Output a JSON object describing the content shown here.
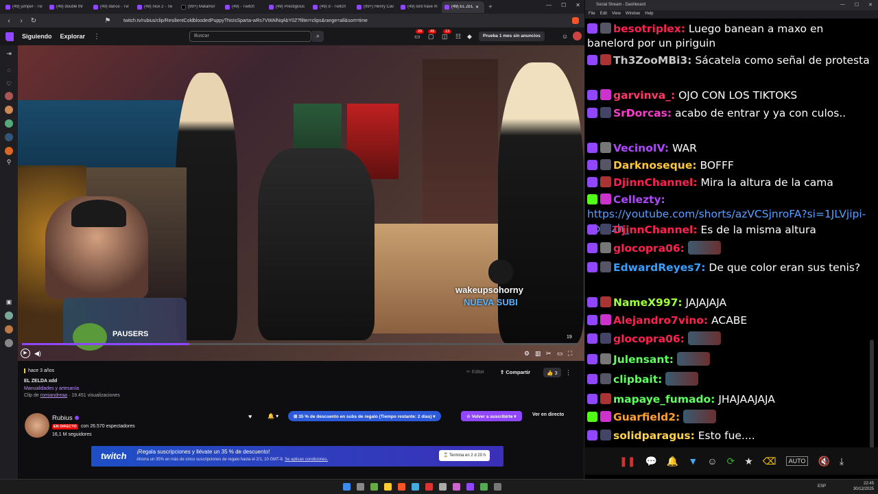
{
  "browser": {
    "tabs": [
      {
        "label": "(49) jumper - Tw"
      },
      {
        "label": "(49) double thr"
      },
      {
        "label": "(49) dance - Tw"
      },
      {
        "label": "(49) nice 2 - Tw"
      },
      {
        "label": "(99+) Matamor"
      },
      {
        "label": "(49) - Twitch"
      },
      {
        "label": "(49) Prestigious"
      },
      {
        "label": "(49) d - Twitch"
      },
      {
        "label": "(99+) Henry Cav"
      },
      {
        "label": "(49) lord have m"
      },
      {
        "label": "(49) EL ZEL"
      }
    ],
    "url": "twitch.tv/rubius/clip/ResilientColdbloodedPuppyThisIsSparta-wRs7VWAlNqAbY0Z?filter=clips&range=all&sort=time"
  },
  "twitch_top": {
    "following": "Siguiendo",
    "explore": "Explorar",
    "search_placeholder": "Buscar",
    "badge_1": "29",
    "badge_2": "49",
    "badge_3": "13",
    "prime": "Prueba 1 mes sin anuncios"
  },
  "player": {
    "overlay_user": "wakeupsohorny",
    "overlay_sub": "NUEVA SUBI",
    "pausers": "PAUSERS",
    "counter": "19"
  },
  "clip": {
    "date": "hace 3 años",
    "title": "EL ZELDA xdd",
    "category": "Manualidades y artesanía",
    "by_prefix": "Clip de",
    "author": "romiandreaa",
    "views": "· 19.451 visualizaciones",
    "edit": "Editar",
    "share": "Compartir",
    "likes": "3"
  },
  "channel": {
    "name": "Rubius",
    "live": "EN DIRECTO",
    "viewers": "con 26.570 espectadores",
    "followers": "16,1 M seguidores",
    "promo": "35 % de descuento en subs de regalo (Tiempo restante: 2 días)",
    "resub": "Volver a suscribirte",
    "watch_live": "Ver en directo"
  },
  "banner": {
    "logo": "twitch",
    "headline": "¡Regala suscripciones y llévate un 35 % de descuento!",
    "subtext": "Ahorra un 35% en más de cinco suscripciones de regalo hasta el 2/1, 10 GMT-8.",
    "terms": "Se aplican condiciones.",
    "timer": "Termina en 2 d 20 h"
  },
  "chat_window": {
    "title": "Social Stream - Dashboard",
    "menu": [
      "File",
      "Edit",
      "View",
      "Window",
      "Help"
    ]
  },
  "chat": [
    {
      "user": "besotriplex:",
      "color": "#ff2050",
      "text": "Luego banean a maxo en banelord por un piriguin",
      "icon": "tw"
    },
    {
      "user": "Th3ZooMBi3:",
      "color": "#c8c8c8",
      "text": "Sácatela como señal de protesta",
      "icon": "tw"
    },
    {
      "user": "garvinva_:",
      "color": "#ff3a6a",
      "text": "OJO CON LOS TIKTOKS",
      "icon": "tw"
    },
    {
      "user": "SrDorcas:",
      "color": "#ff3ad0",
      "text": "acabo de entrar y ya con culos..",
      "icon": "tw"
    },
    {
      "user": "VecinoIV:",
      "color": "#b048ff",
      "text": "WAR",
      "icon": "tw"
    },
    {
      "user": "Darknoseque:",
      "color": "#ffc83a",
      "text": "BOFFF",
      "icon": "tw"
    },
    {
      "user": "DjinnChannel:",
      "color": "#ff2050",
      "text": "Mira la altura de la cama",
      "icon": "tw"
    },
    {
      "user": "Cellezty:",
      "color": "#b048ff",
      "text": "https://youtube.com/shorts/azVCSjnroFA?si=1JLVjipi-obtKzh_",
      "icon": "kick"
    },
    {
      "user": "DjinnChannel:",
      "color": "#ff2050",
      "text": "Es de la misma altura",
      "icon": "tw"
    },
    {
      "user": "glocopra06:",
      "color": "#ff2050",
      "text": "",
      "icon": "tw"
    },
    {
      "user": "EdwardReyes7:",
      "color": "#3aa0ff",
      "text": "De que color eran sus tenis?",
      "icon": "tw"
    },
    {
      "user": "NameX997:",
      "color": "#a0ff3a",
      "text": "JAJAJAJA",
      "icon": "tw"
    },
    {
      "user": "Alejandro7vino:",
      "color": "#ff2050",
      "text": "ACABE",
      "icon": "tw"
    },
    {
      "user": "glocopra06:",
      "color": "#ff2050",
      "text": "",
      "icon": "tw"
    },
    {
      "user": "Julensant:",
      "color": "#60ff60",
      "text": "",
      "icon": "tw"
    },
    {
      "user": "clipbait:",
      "color": "#60ff60",
      "text": "",
      "icon": "tw"
    },
    {
      "user": "mapaye_fumado:",
      "color": "#60ff60",
      "text": "JHAJAAJAJA",
      "icon": "tw"
    },
    {
      "user": "Guarfield2:",
      "color": "#ffa030",
      "text": "",
      "icon": "kick"
    },
    {
      "user": "solidparagus:",
      "color": "#ffd24a",
      "text": "Esto fue....",
      "icon": "tw"
    }
  ],
  "taskbar": {
    "lang": "ESP",
    "time": "22:45",
    "date": "30/12/2025"
  }
}
